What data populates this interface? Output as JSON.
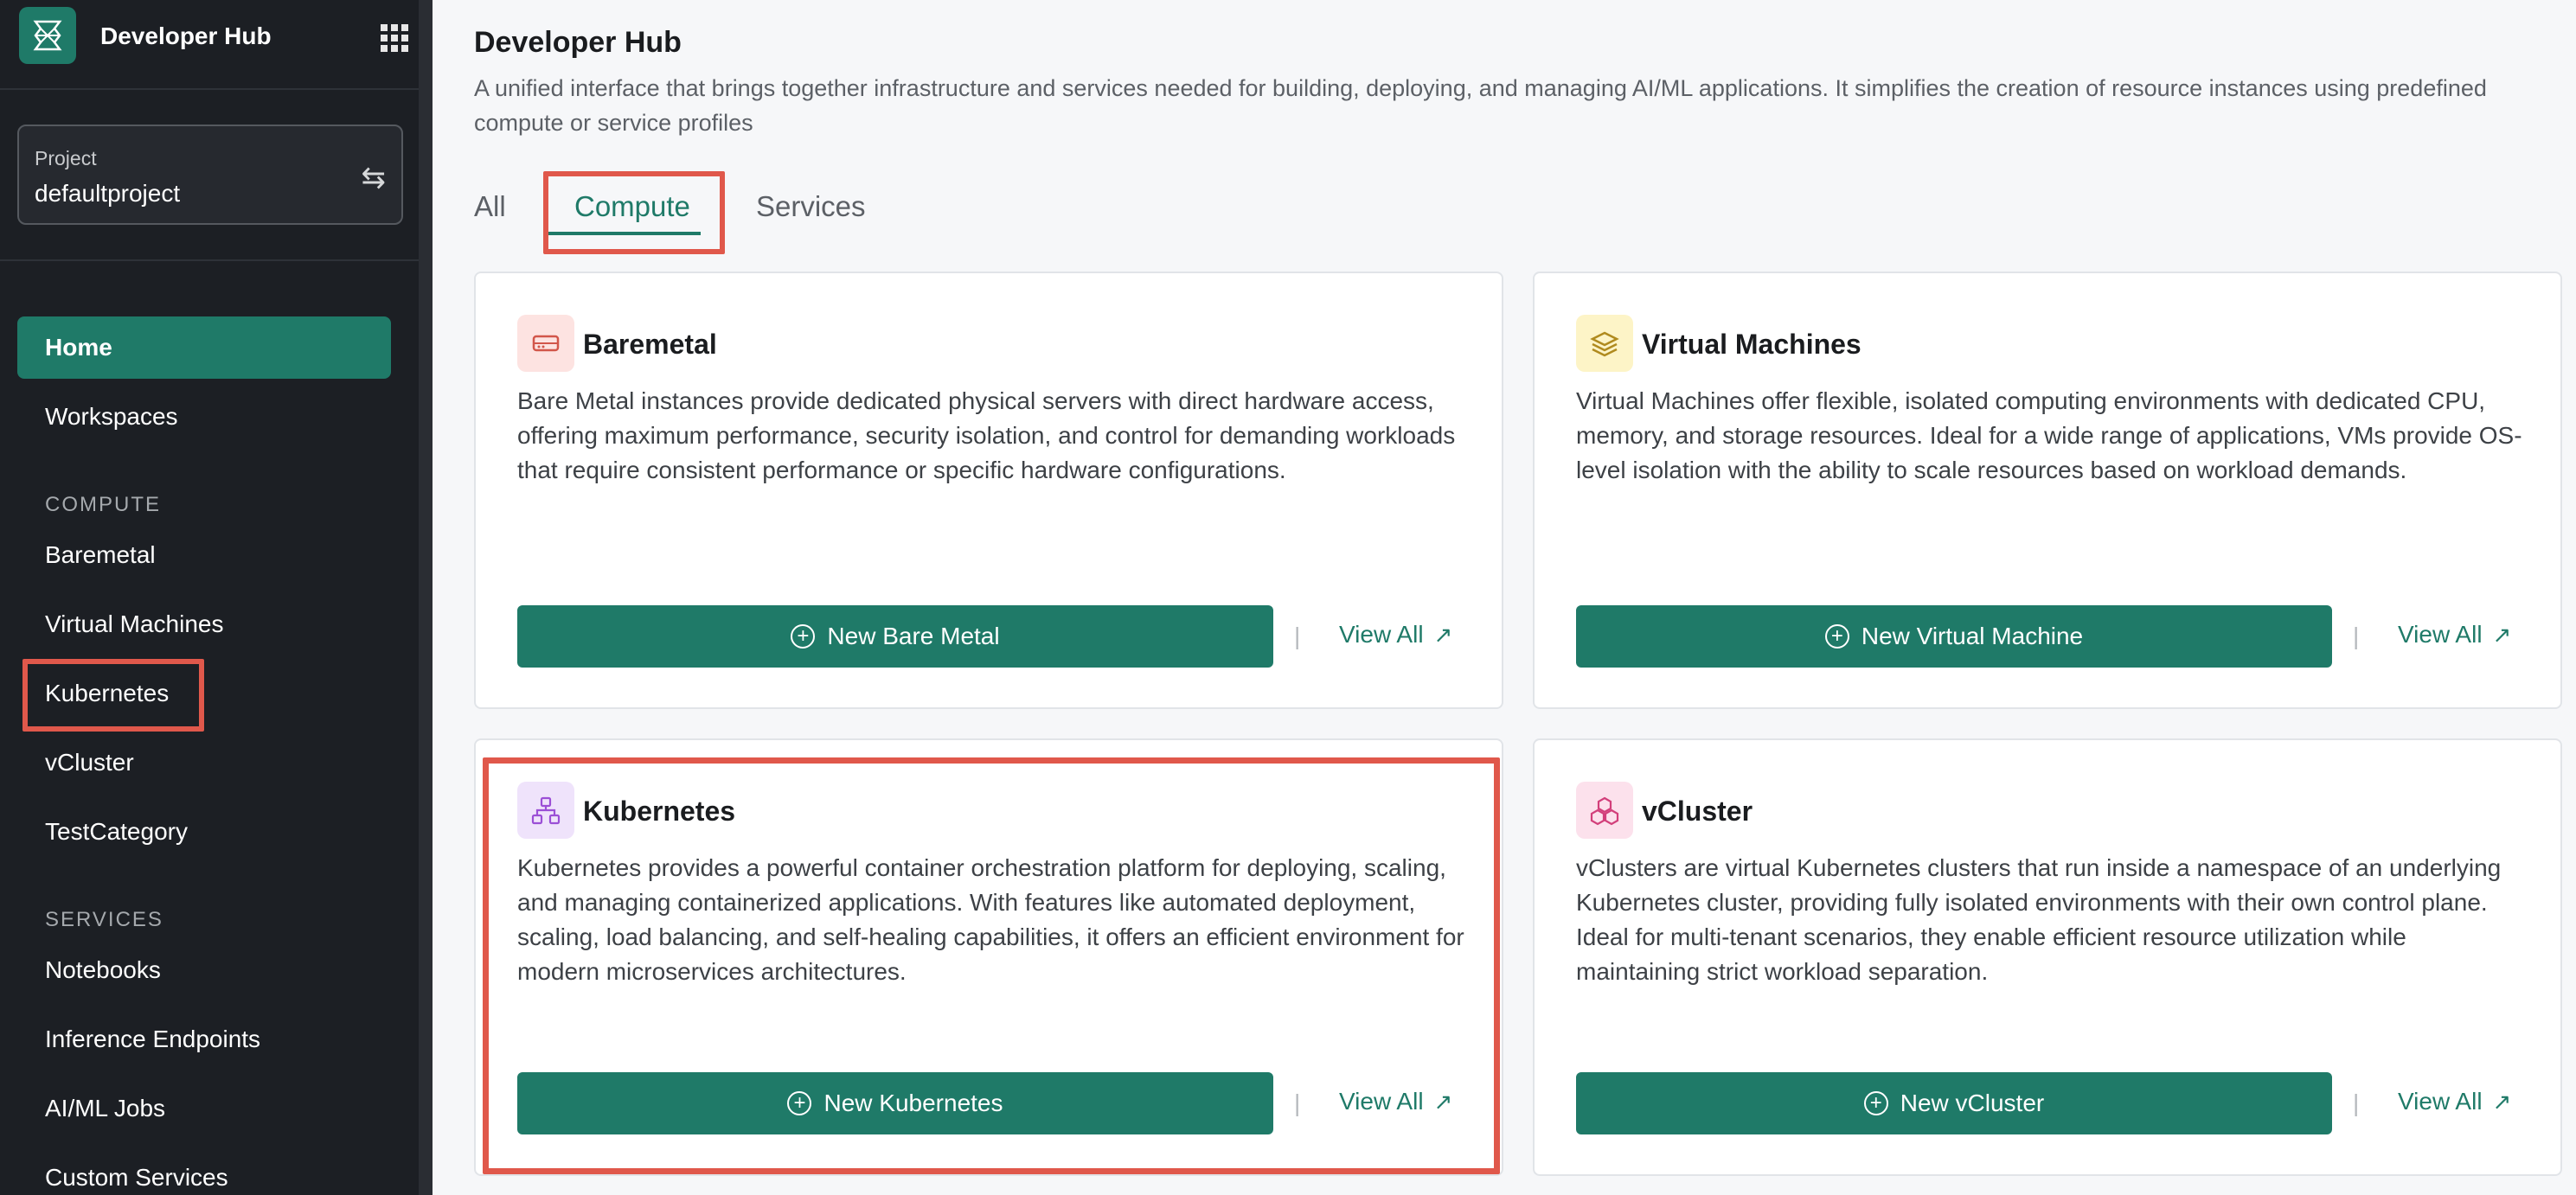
{
  "app": {
    "title": "Developer Hub"
  },
  "project": {
    "label": "Project",
    "value": "defaultproject"
  },
  "sidebar": {
    "items": [
      {
        "label": "Home"
      },
      {
        "label": "Workspaces"
      }
    ],
    "compute_section": "COMPUTE",
    "compute_items": [
      {
        "label": "Baremetal"
      },
      {
        "label": "Virtual Machines"
      },
      {
        "label": "Kubernetes"
      },
      {
        "label": "vCluster"
      },
      {
        "label": "TestCategory"
      }
    ],
    "services_section": "SERVICES",
    "services_items": [
      {
        "label": "Notebooks"
      },
      {
        "label": "Inference Endpoints"
      },
      {
        "label": "AI/ML Jobs"
      },
      {
        "label": "Custom Services"
      }
    ]
  },
  "main": {
    "title": "Developer Hub",
    "description": "A unified interface that brings together infrastructure and services needed for building, deploying, and managing AI/ML applications. It simplifies the creation of resource instances using predefined compute or service profiles",
    "tabs": [
      {
        "label": "All"
      },
      {
        "label": "Compute"
      },
      {
        "label": "Services"
      }
    ],
    "active_tab": "Compute",
    "cards": [
      {
        "title": "Baremetal",
        "description": "Bare Metal instances provide dedicated physical servers with direct hardware access, offering maximum performance, security isolation, and control for demanding workloads that require consistent performance or specific hardware configurations.",
        "button": "New Bare Metal",
        "view_all": "View All",
        "icon": "server-icon"
      },
      {
        "title": "Virtual Machines",
        "description": "Virtual Machines offer flexible, isolated computing environments with dedicated CPU, memory, and storage resources. Ideal for a wide range of applications, VMs provide OS-level isolation with the ability to scale resources based on workload demands.",
        "button": "New Virtual Machine",
        "view_all": "View All",
        "icon": "layers-icon"
      },
      {
        "title": "Kubernetes",
        "description": "Kubernetes provides a powerful container orchestration platform for deploying, scaling, and managing containerized applications. With features like automated deployment, scaling, load balancing, and self-healing capabilities, it offers an efficient environment for modern microservices architectures.",
        "button": "New Kubernetes",
        "view_all": "View All",
        "icon": "network-icon"
      },
      {
        "title": "vCluster",
        "description": "vClusters are virtual Kubernetes clusters that run inside a namespace of an underlying Kubernetes cluster, providing fully isolated environments with their own control plane. Ideal for multi-tenant scenarios, they enable efficient resource utilization while maintaining strict workload separation.",
        "button": "New vCluster",
        "view_all": "View All",
        "icon": "boxes-icon"
      }
    ]
  },
  "colors": {
    "accent": "#1f7a68",
    "sidebar_bg": "#1c1f24",
    "highlight": "#e0584b"
  }
}
